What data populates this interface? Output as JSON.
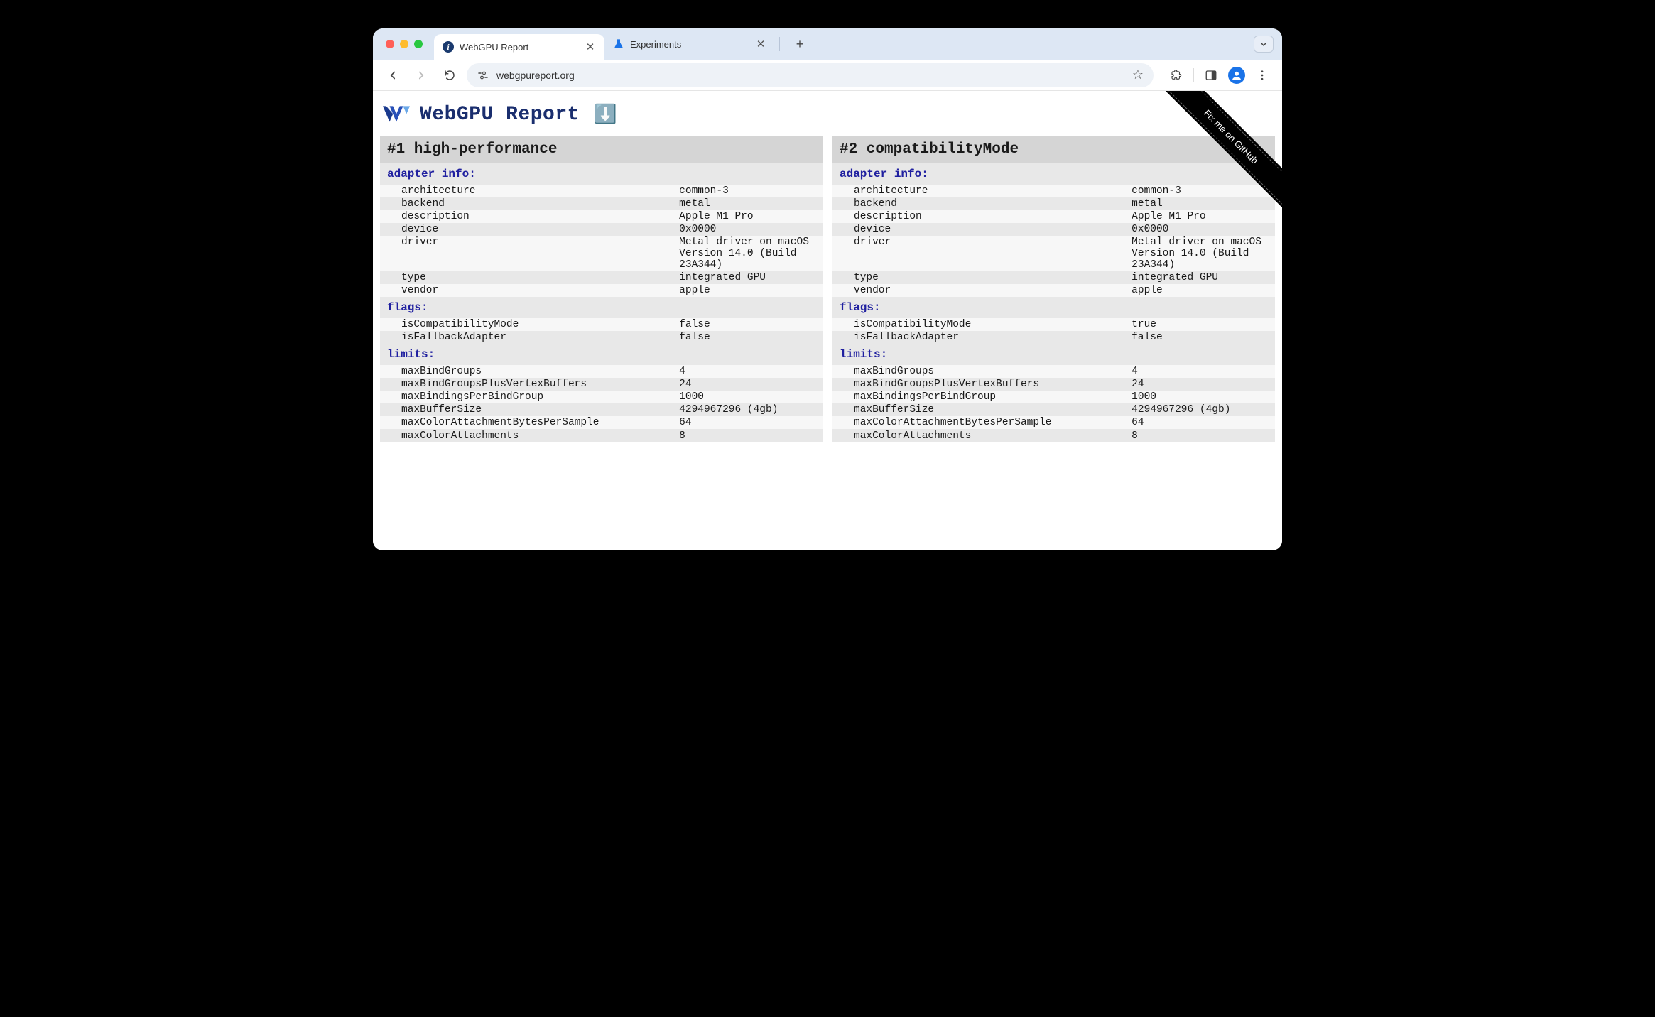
{
  "browser": {
    "tabs": [
      {
        "title": "WebGPU Report",
        "active": true,
        "favicon": "info"
      },
      {
        "title": "Experiments",
        "active": false,
        "favicon": "flask"
      }
    ],
    "url": "webgpureport.org"
  },
  "page": {
    "title": "WebGPU Report",
    "download_icon": "⬇️",
    "github_ribbon": "Fix me on GitHub"
  },
  "adapters": [
    {
      "heading": "#1 high-performance",
      "sections": {
        "adapter_info_title": "adapter info:",
        "adapter_info": [
          {
            "k": "architecture",
            "v": "common-3"
          },
          {
            "k": "backend",
            "v": "metal"
          },
          {
            "k": "description",
            "v": "Apple M1 Pro"
          },
          {
            "k": "device",
            "v": "0x0000"
          },
          {
            "k": "driver",
            "v": "Metal driver on macOS Version 14.0 (Build 23A344)"
          },
          {
            "k": "type",
            "v": "integrated GPU"
          },
          {
            "k": "vendor",
            "v": "apple"
          }
        ],
        "flags_title": "flags:",
        "flags": [
          {
            "k": "isCompatibilityMode",
            "v": "false"
          },
          {
            "k": "isFallbackAdapter",
            "v": "false"
          }
        ],
        "limits_title": "limits:",
        "limits": [
          {
            "k": "maxBindGroups",
            "v": "4"
          },
          {
            "k": "maxBindGroupsPlusVertexBuffers",
            "v": "24"
          },
          {
            "k": "maxBindingsPerBindGroup",
            "v": "1000"
          },
          {
            "k": "maxBufferSize",
            "v": "4294967296 (4gb)",
            "hl": true
          },
          {
            "k": "maxColorAttachmentBytesPerSample",
            "v": "64",
            "hl": true
          },
          {
            "k": "maxColorAttachments",
            "v": "8",
            "cutoff": true
          }
        ]
      }
    },
    {
      "heading": "#2 compatibilityMode",
      "sections": {
        "adapter_info_title": "adapter info:",
        "adapter_info": [
          {
            "k": "architecture",
            "v": "common-3"
          },
          {
            "k": "backend",
            "v": "metal"
          },
          {
            "k": "description",
            "v": "Apple M1 Pro"
          },
          {
            "k": "device",
            "v": "0x0000"
          },
          {
            "k": "driver",
            "v": "Metal driver on macOS Version 14.0 (Build 23A344)"
          },
          {
            "k": "type",
            "v": "integrated GPU"
          },
          {
            "k": "vendor",
            "v": "apple"
          }
        ],
        "flags_title": "flags:",
        "flags": [
          {
            "k": "isCompatibilityMode",
            "v": "true"
          },
          {
            "k": "isFallbackAdapter",
            "v": "false"
          }
        ],
        "limits_title": "limits:",
        "limits": [
          {
            "k": "maxBindGroups",
            "v": "4"
          },
          {
            "k": "maxBindGroupsPlusVertexBuffers",
            "v": "24"
          },
          {
            "k": "maxBindingsPerBindGroup",
            "v": "1000"
          },
          {
            "k": "maxBufferSize",
            "v": "4294967296 (4gb)",
            "hl": true
          },
          {
            "k": "maxColorAttachmentBytesPerSample",
            "v": "64",
            "hl": true
          },
          {
            "k": "maxColorAttachments",
            "v": "8",
            "cutoff": true
          }
        ]
      }
    }
  ]
}
